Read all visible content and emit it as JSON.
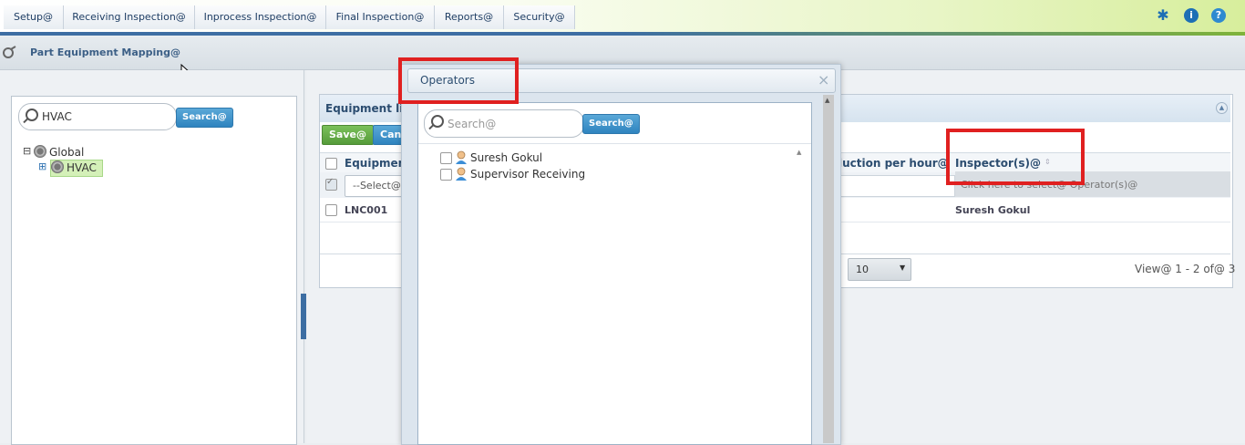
{
  "nav": {
    "tabs": [
      "Setup@",
      "Receiving Inspection@",
      "Inprocess Inspection@",
      "Final Inspection@",
      "Reports@",
      "Security@"
    ],
    "icons": [
      "pin-icon",
      "info-icon",
      "help-icon"
    ]
  },
  "header": {
    "title": "Part Equipment Mapping@"
  },
  "tree": {
    "search_value": "HVAC",
    "search_button": "Search@",
    "nodes": [
      {
        "label": "Global",
        "expander": "⊟"
      },
      {
        "label": "HVAC",
        "expander": "⊞"
      }
    ]
  },
  "grid": {
    "title": "Equipment link",
    "save_label": "Save@",
    "cancel_label": "Canc",
    "columns": [
      "Equipment",
      "luction per hour@",
      "Inspector(s)@"
    ],
    "filter_select": "--Select@--",
    "filter_operators": "Click here to select@ Operator(s)@",
    "rows": [
      {
        "equipment": "LNC001",
        "inspectors": "Suresh Gokul"
      }
    ],
    "page_size": "10",
    "page_size_arrow": "▼",
    "view_info": "View@ 1 - 2 of@ 3",
    "collapse_icon": "▲"
  },
  "modal": {
    "title": "Operators",
    "close": "×",
    "search_placeholder": "Search@",
    "search_button": "Search@",
    "operators": [
      "Suresh Gokul",
      "Supervisor Receiving"
    ]
  },
  "colors": {
    "accent_blue": "#2f84bf",
    "save_green": "#6aaa4c",
    "highlight_red": "#e02020"
  }
}
